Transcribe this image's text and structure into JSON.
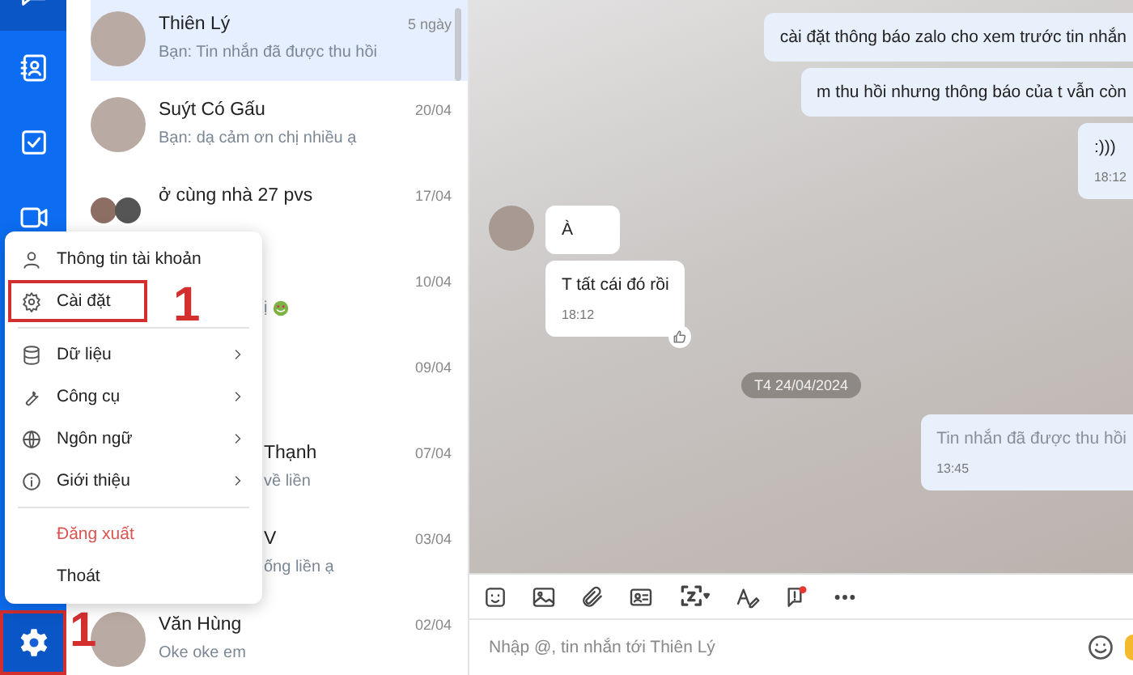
{
  "nav": {
    "items": [
      {
        "kind": "chat",
        "selected": true
      },
      {
        "kind": "contacts",
        "selected": false
      },
      {
        "kind": "todo",
        "selected": false
      },
      {
        "kind": "cloud",
        "selected": false
      }
    ],
    "settings": {
      "selected": true,
      "highlighted": true,
      "callout": "1"
    }
  },
  "conversations": [
    {
      "kind": "full",
      "name": "Thiên Lý",
      "preview": "Bạn: Tin nhắn đã được thu hồi",
      "time": "5 ngày",
      "selected": true
    },
    {
      "kind": "full",
      "name": "Suýt Có Gấu",
      "preview": "Bạn: dạ cảm ơn chị nhiều ạ",
      "time": "20/04",
      "selected": false
    },
    {
      "kind": "group",
      "name": "ở cùng nhà 27 pvs",
      "time": "17/04",
      "selected": false
    },
    {
      "kind": "covered",
      "preview": "ị",
      "emoji": true,
      "time": "10/04",
      "selected": false
    },
    {
      "kind": "covered",
      "time": "09/04",
      "selected": false
    },
    {
      "kind": "covered",
      "name": "Thạnh",
      "preview": "về liền",
      "time": "07/04",
      "selected": false
    },
    {
      "kind": "covered",
      "name": "V",
      "preview": "ống liền ạ",
      "time": "03/04",
      "selected": false
    },
    {
      "kind": "full",
      "name": "Văn Hùng",
      "preview": "Oke oke em",
      "time": "02/04",
      "selected": false
    }
  ],
  "menu": {
    "items": [
      {
        "kind": "account",
        "label": "Thông tin tài khoản",
        "submenu": false,
        "highlighted": false
      },
      {
        "kind": "settings",
        "label": "Cài đặt",
        "submenu": false,
        "highlighted": true,
        "callout": "1"
      },
      {
        "kind": "divider"
      },
      {
        "kind": "data",
        "label": "Dữ liệu",
        "submenu": true,
        "highlighted": false
      },
      {
        "kind": "tools",
        "label": "Công cụ",
        "submenu": true,
        "highlighted": false
      },
      {
        "kind": "language",
        "label": "Ngôn ngữ",
        "submenu": true,
        "highlighted": false
      },
      {
        "kind": "about",
        "label": "Giới thiệu",
        "submenu": true,
        "highlighted": false
      },
      {
        "kind": "divider"
      },
      {
        "kind": "logout",
        "label": "Đăng xuất",
        "submenu": false,
        "highlighted": false
      },
      {
        "kind": "exit",
        "label": "Thoát",
        "submenu": false,
        "highlighted": false
      }
    ]
  },
  "messages": [
    {
      "kind": "out",
      "text": "cài đặt thông báo zalo cho xem trước tin nhắn",
      "recalled": false,
      "reaction": false
    },
    {
      "kind": "out",
      "text": "m thu hồi nhưng thông báo của t vẫn còn",
      "recalled": false,
      "reaction": false
    },
    {
      "kind": "out",
      "text": ":)))",
      "time": "18:12",
      "recalled": false,
      "reaction": false
    },
    {
      "kind": "in",
      "text": "À",
      "recalled": false,
      "avatar": true,
      "reaction": false
    },
    {
      "kind": "in",
      "text": "T tất cái đó rồi",
      "time": "18:12",
      "recalled": false,
      "avatar": false,
      "reaction": true
    },
    {
      "kind": "date",
      "text": "T4 24/04/2024"
    },
    {
      "kind": "out",
      "text": "Tin nhắn đã được thu hồi",
      "time": "13:45",
      "recalled": true,
      "reaction": false
    }
  ],
  "composer": {
    "tools": [
      {
        "kind": "sticker"
      },
      {
        "kind": "image"
      },
      {
        "kind": "attach"
      },
      {
        "kind": "card"
      },
      {
        "kind": "capture"
      },
      {
        "kind": "format"
      },
      {
        "kind": "reminder"
      },
      {
        "kind": "more"
      }
    ],
    "placeholder": "Nhập @, tin nhắn tới Thiên Lý"
  }
}
